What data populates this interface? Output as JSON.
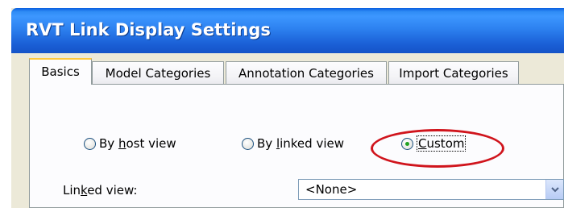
{
  "window": {
    "title": "RVT Link Display Settings"
  },
  "tabs": [
    {
      "label": "Basics",
      "active": true
    },
    {
      "label": "Model Categories",
      "active": false
    },
    {
      "label": "Annotation Categories",
      "active": false
    },
    {
      "label": "Import Categories",
      "active": false
    }
  ],
  "display_mode": {
    "options": [
      {
        "label_pre": "By ",
        "label_mnemonic": "h",
        "label_post": "ost view",
        "checked": false
      },
      {
        "label_pre": "By ",
        "label_mnemonic": "l",
        "label_post": "inked view",
        "checked": false
      },
      {
        "label_pre": "",
        "label_mnemonic": "C",
        "label_post": "ustom",
        "checked": true
      }
    ]
  },
  "linked_view": {
    "label_pre": "Lin",
    "label_mnemonic": "k",
    "label_post": "ed view:",
    "value": "<None>"
  },
  "colors": {
    "titlebar": "#2d82f0",
    "highlight": "#d0141c",
    "tab_active_accent": "#ffc83c"
  }
}
